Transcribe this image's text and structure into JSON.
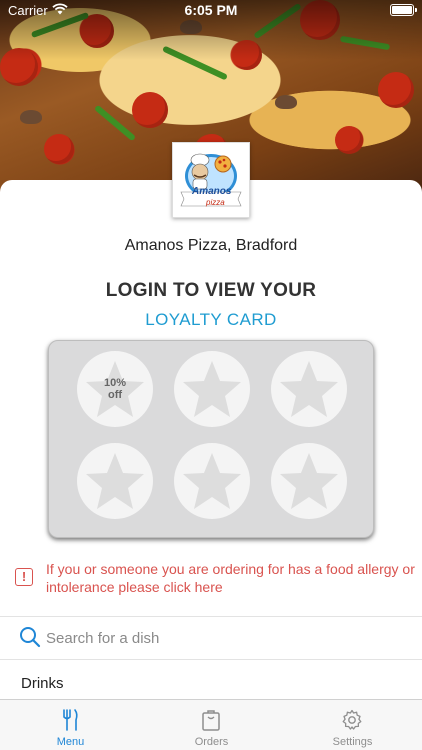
{
  "status_bar": {
    "carrier": "Carrier",
    "time": "6:05 PM"
  },
  "logo": {
    "brand_text": "Amanos",
    "sub_text": "pizza"
  },
  "restaurant_name": "Amanos Pizza, Bradford",
  "loyalty": {
    "title": "LOGIN TO VIEW YOUR",
    "link_label": "LOYALTY CARD",
    "stamps": [
      {
        "reward": "10%\noff",
        "icon": "star-icon"
      },
      {
        "reward": "",
        "icon": "star-icon"
      },
      {
        "reward": "",
        "icon": "star-icon"
      },
      {
        "reward": "",
        "icon": "star-icon"
      },
      {
        "reward": "",
        "icon": "star-icon"
      },
      {
        "reward": "",
        "icon": "star-icon"
      }
    ]
  },
  "allergy_notice": {
    "icon": "warning-icon",
    "text": "If you or someone you are ordering for has a food allergy or intolerance please click here"
  },
  "search": {
    "placeholder": "Search for a dish",
    "icon": "search-icon"
  },
  "menu_category": "Drinks",
  "tabs": [
    {
      "label": "Menu",
      "icon": "fork-knife-icon",
      "active": true
    },
    {
      "label": "Orders",
      "icon": "bag-icon",
      "active": false
    },
    {
      "label": "Settings",
      "icon": "gear-icon",
      "active": false
    }
  ],
  "colors": {
    "accent": "#1f86d6",
    "link": "#1f9cd1",
    "warning": "#d9534f",
    "card_bg": "#dadadb"
  }
}
